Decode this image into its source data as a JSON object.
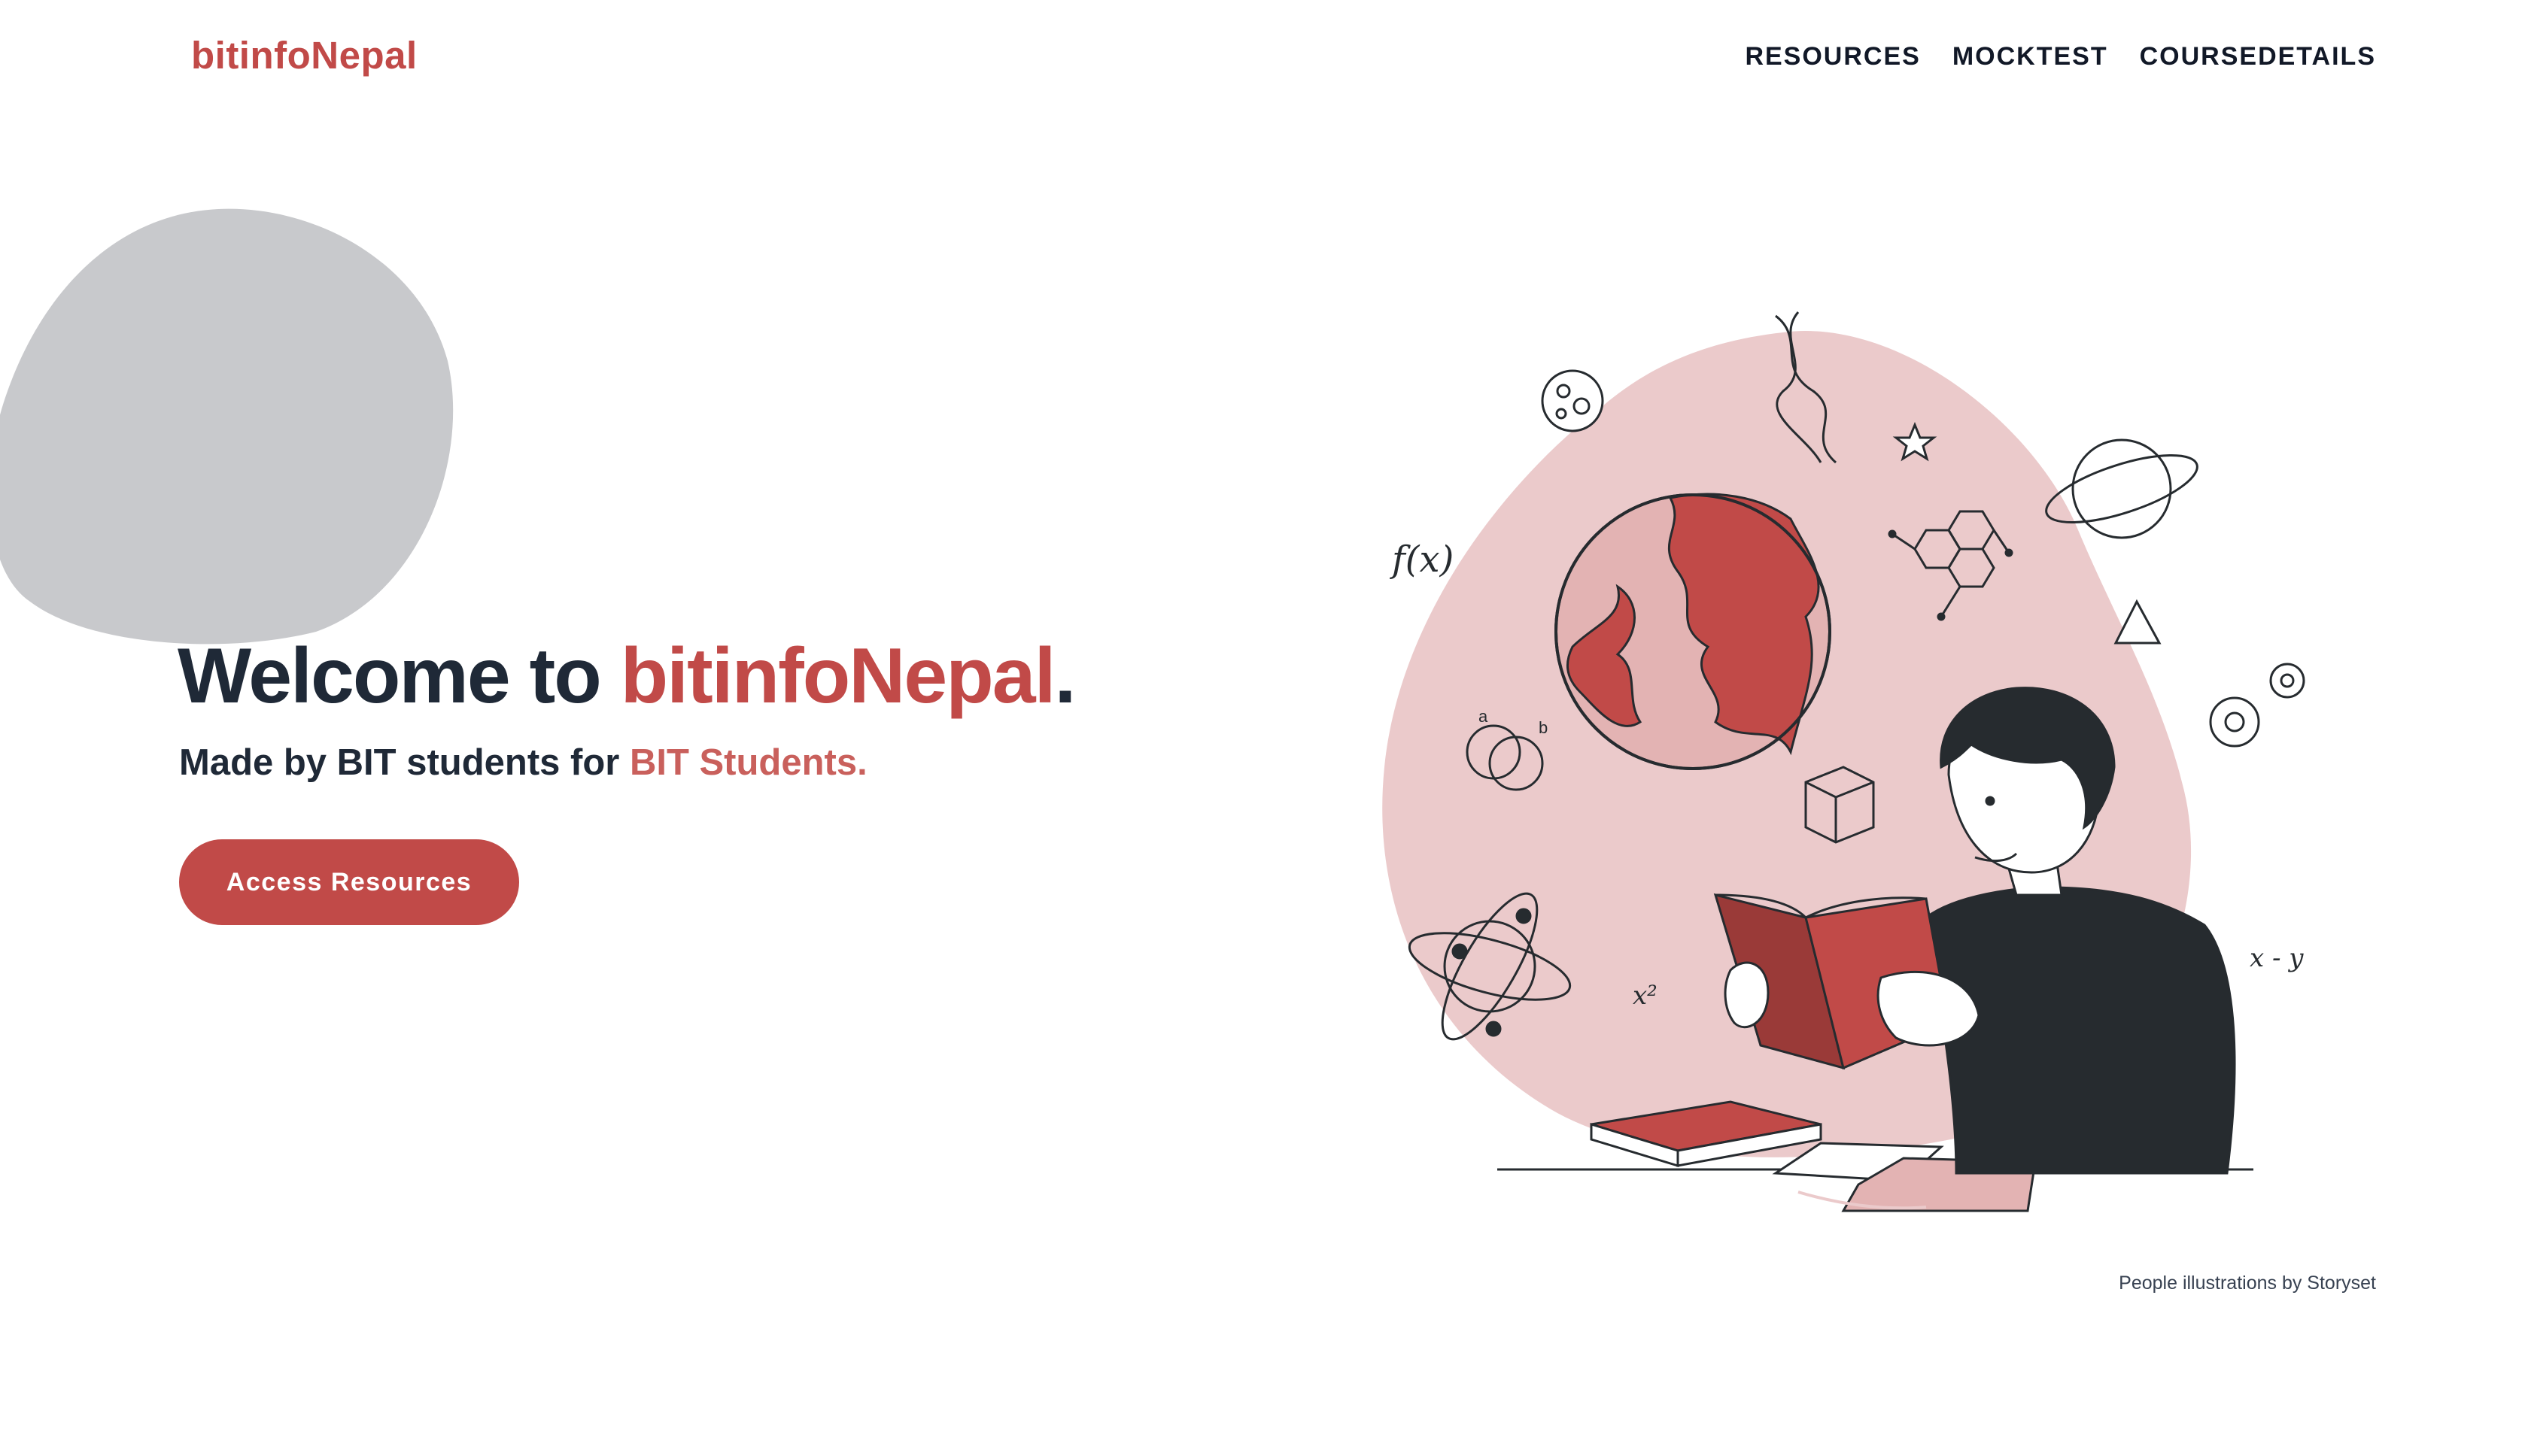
{
  "header": {
    "logo": "bitinfoNepal",
    "nav": [
      {
        "label": "RESOURCES"
      },
      {
        "label": "MOCKTEST"
      },
      {
        "label": "COURSEDETAILS"
      }
    ]
  },
  "hero": {
    "title_prefix": "Welcome to ",
    "title_brand": "bitinfoNepal",
    "title_suffix": ".",
    "subtitle_prefix": "Made by BIT students for ",
    "subtitle_accent": "BIT Students.",
    "cta_label": "Access Resources"
  },
  "illustration": {
    "math_fx": "f(x)",
    "math_x2": "x²",
    "math_xy": "x - y",
    "set_a": "a",
    "set_b": "b"
  },
  "credit": "People illustrations by Storyset",
  "colors": {
    "brand": "#c14a48",
    "brand_light": "#c9605c",
    "heading": "#1f2937",
    "blob_grey": "#c8c9cc",
    "blob_pink": "#ebcacb"
  }
}
